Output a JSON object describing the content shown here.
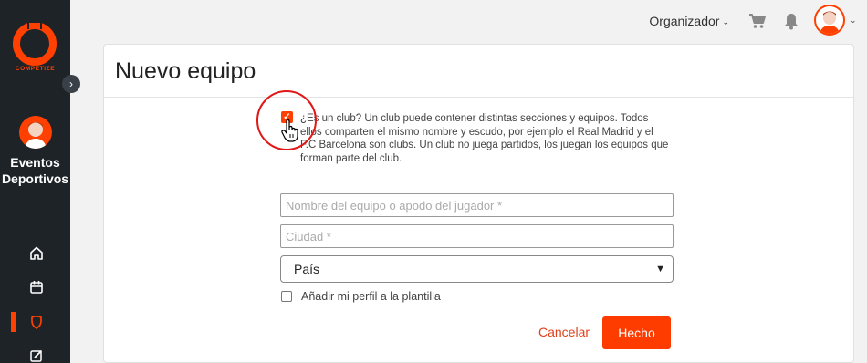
{
  "brand": {
    "logo_text": "COMPETIZE",
    "accent": "#ff4000"
  },
  "sidebar": {
    "title": "Eventos Deportivos",
    "nav": [
      {
        "icon": "home-icon",
        "active": false
      },
      {
        "icon": "calendar-icon",
        "active": false
      },
      {
        "icon": "shield-icon",
        "active": true
      },
      {
        "icon": "edit-icon",
        "active": false
      }
    ]
  },
  "topbar": {
    "role_label": "Organizador",
    "icons": [
      "cart-icon",
      "bell-icon",
      "avatar"
    ]
  },
  "form": {
    "title": "Nuevo equipo",
    "club_checked": true,
    "club_text": "¿Es un club? Un club puede contener distintas secciones y equipos. Todos ellos comparten el mismo nombre y escudo, por ejemplo el Real Madrid y el F.C Barcelona son clubs. Un club no juega partidos, los juegan los equipos que forman parte del club.",
    "name_placeholder": "Nombre del equipo o apodo del jugador *",
    "city_placeholder": "Ciudad *",
    "country_selected": "País",
    "add_profile_label": "Añadir mi perfil a la plantilla",
    "add_profile_checked": false,
    "cancel_label": "Cancelar",
    "done_label": "Hecho"
  }
}
